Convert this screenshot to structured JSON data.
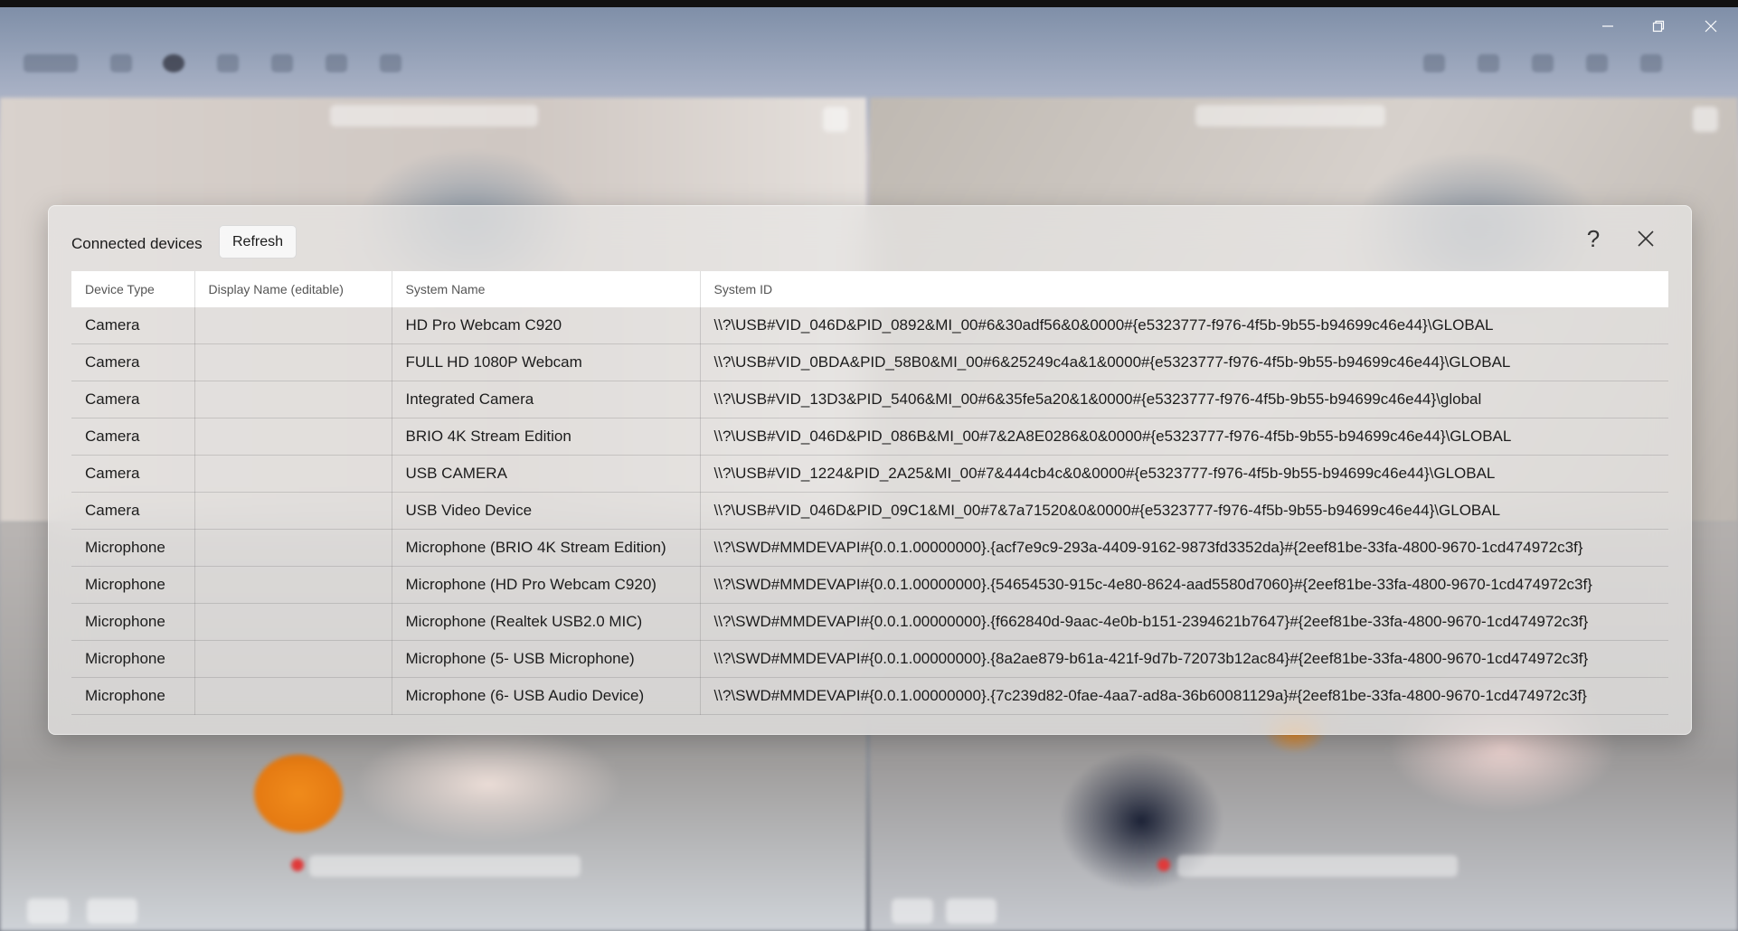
{
  "dialog": {
    "title": "Connected devices",
    "refresh_label": "Refresh",
    "help_label": "?"
  },
  "table": {
    "headers": [
      "Device Type",
      "Display Name (editable)",
      "System Name",
      "System ID"
    ],
    "rows": [
      {
        "type": "Camera",
        "display_name": "",
        "system_name": "HD Pro Webcam C920",
        "system_id": "\\\\?\\USB#VID_046D&PID_0892&MI_00#6&30adf56&0&0000#{e5323777-f976-4f5b-9b55-b94699c46e44}\\GLOBAL"
      },
      {
        "type": "Camera",
        "display_name": "",
        "system_name": "FULL HD 1080P Webcam",
        "system_id": "\\\\?\\USB#VID_0BDA&PID_58B0&MI_00#6&25249c4a&1&0000#{e5323777-f976-4f5b-9b55-b94699c46e44}\\GLOBAL"
      },
      {
        "type": "Camera",
        "display_name": "",
        "system_name": "Integrated Camera",
        "system_id": "\\\\?\\USB#VID_13D3&PID_5406&MI_00#6&35fe5a20&1&0000#{e5323777-f976-4f5b-9b55-b94699c46e44}\\global"
      },
      {
        "type": "Camera",
        "display_name": "",
        "system_name": "BRIO 4K Stream Edition",
        "system_id": "\\\\?\\USB#VID_046D&PID_086B&MI_00#7&2A8E0286&0&0000#{e5323777-f976-4f5b-9b55-b94699c46e44}\\GLOBAL"
      },
      {
        "type": "Camera",
        "display_name": "",
        "system_name": "USB CAMERA",
        "system_id": "\\\\?\\USB#VID_1224&PID_2A25&MI_00#7&444cb4c&0&0000#{e5323777-f976-4f5b-9b55-b94699c46e44}\\GLOBAL"
      },
      {
        "type": "Camera",
        "display_name": "",
        "system_name": "USB Video Device",
        "system_id": "\\\\?\\USB#VID_046D&PID_09C1&MI_00#7&7a71520&0&0000#{e5323777-f976-4f5b-9b55-b94699c46e44}\\GLOBAL"
      },
      {
        "type": "Microphone",
        "display_name": "",
        "system_name": "Microphone (BRIO 4K Stream Edition)",
        "system_id": "\\\\?\\SWD#MMDEVAPI#{0.0.1.00000000}.{acf7e9c9-293a-4409-9162-9873fd3352da}#{2eef81be-33fa-4800-9670-1cd474972c3f}"
      },
      {
        "type": "Microphone",
        "display_name": "",
        "system_name": "Microphone (HD Pro Webcam C920)",
        "system_id": "\\\\?\\SWD#MMDEVAPI#{0.0.1.00000000}.{54654530-915c-4e80-8624-aad5580d7060}#{2eef81be-33fa-4800-9670-1cd474972c3f}"
      },
      {
        "type": "Microphone",
        "display_name": "",
        "system_name": "Microphone (Realtek USB2.0 MIC)",
        "system_id": "\\\\?\\SWD#MMDEVAPI#{0.0.1.00000000}.{f662840d-9aac-4e0b-b151-2394621b7647}#{2eef81be-33fa-4800-9670-1cd474972c3f}"
      },
      {
        "type": "Microphone",
        "display_name": "",
        "system_name": "Microphone (5- USB Microphone)",
        "system_id": "\\\\?\\SWD#MMDEVAPI#{0.0.1.00000000}.{8a2ae879-b61a-421f-9d7b-72073b12ac84}#{2eef81be-33fa-4800-9670-1cd474972c3f}"
      },
      {
        "type": "Microphone",
        "display_name": "",
        "system_name": "Microphone (6- USB Audio Device)",
        "system_id": "\\\\?\\SWD#MMDEVAPI#{0.0.1.00000000}.{7c239d82-0fae-4aa7-ad8a-36b60081129a}#{2eef81be-33fa-4800-9670-1cd474972c3f}"
      }
    ]
  }
}
